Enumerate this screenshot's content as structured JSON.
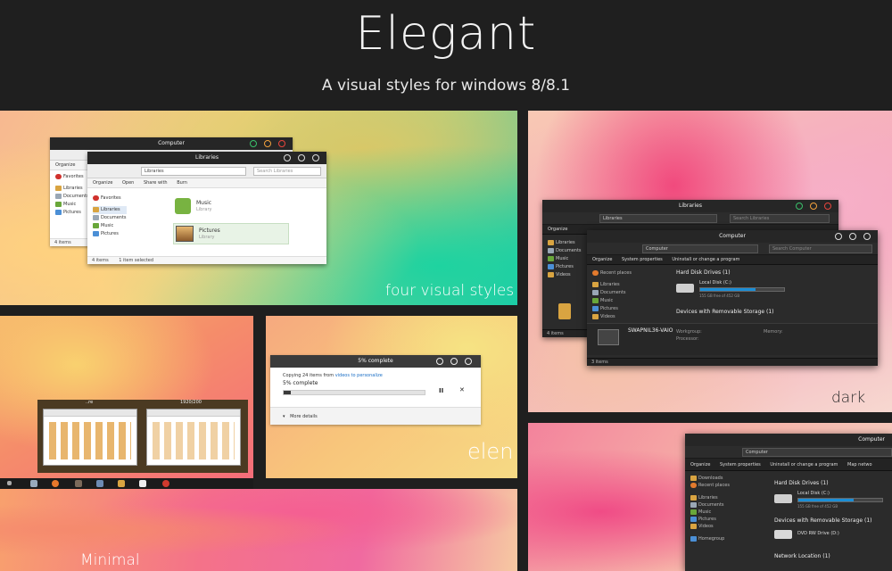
{
  "header": {
    "title": "Elegant",
    "subtitle": "A visual styles for windows 8/8.1"
  },
  "tiles": {
    "four": {
      "label": "four visual styles"
    },
    "dark": {
      "label": "dark"
    },
    "elem": {
      "label": "elen"
    },
    "minimal": {
      "label": "Minimal"
    }
  },
  "win_computer_light": {
    "title": "Computer",
    "organize": "Organize",
    "favorites": "Favorites",
    "libraries": "Libraries",
    "documents": "Documents",
    "music": "Music",
    "pictures": "Pictures",
    "items": "4 items"
  },
  "win_libraries_light": {
    "title": "Libraries",
    "address": "Libraries",
    "search_placeholder": "Search Libraries",
    "commands": [
      "Organize",
      "Open",
      "Share with",
      "Burn"
    ],
    "nav": [
      "Favorites",
      "Libraries",
      "Documents",
      "Music",
      "Pictures"
    ],
    "items": [
      {
        "name": "Music",
        "kind": "Library"
      },
      {
        "name": "Pictures",
        "kind": "Library"
      }
    ],
    "status_count": "4 items",
    "status_selected": "1 item selected"
  },
  "win_libraries_dark": {
    "title": "Libraries",
    "address": "Libraries",
    "search_placeholder": "Search Libraries",
    "organize": "Organize",
    "nav": [
      "Libraries",
      "Documents",
      "Music",
      "Pictures",
      "Videos"
    ],
    "status": "4 items"
  },
  "win_computer_dark": {
    "title": "Computer",
    "address": "Computer",
    "search_placeholder": "Search Computer",
    "commands": [
      "Organize",
      "System properties",
      "Uninstall or change a program"
    ],
    "nav": [
      "Recent places",
      "Libraries",
      "Documents",
      "Music",
      "Pictures",
      "Videos"
    ],
    "section_hdd": "Hard Disk Drives (1)",
    "disk_name": "Local Disk (C:)",
    "disk_free": "155 GB free of 452 GB",
    "disk_used_fraction": 0.66,
    "section_removable": "Devices with Removable Storage (1)",
    "computer_name": "SWAPNIL36-VAIO",
    "workgroup_label": "Workgroup:",
    "processor_label": "Processor:",
    "memory_label": "Memory:",
    "status": "3 items"
  },
  "win_computer_dark2": {
    "title": "Computer",
    "address": "Computer",
    "commands": [
      "Organize",
      "System properties",
      "Uninstall or change a program",
      "Map netwo"
    ],
    "nav": [
      "Downloads",
      "Recent places",
      "Libraries",
      "Documents",
      "Music",
      "Pictures",
      "Videos",
      "Homegroup"
    ],
    "section_hdd": "Hard Disk Drives (1)",
    "disk_name": "Local Disk (C:)",
    "disk_free": "155 GB free of 452 GB",
    "disk_used_fraction": 0.66,
    "section_removable": "Devices with Removable Storage (1)",
    "dvd": "DVD RW Drive (D:)",
    "section_network": "Network Location (1)"
  },
  "copy_dialog": {
    "title": "5% complete",
    "line1_prefix": "Copying 24 items from",
    "line1_link": "videos to personalize",
    "line2": "5% complete",
    "progress_fraction": 0.05,
    "pause": "II",
    "cancel": "✕",
    "more_details": "More details"
  },
  "thumbnails": {
    "left_label": "..re",
    "right_label": "1920/200"
  },
  "colors": {
    "background": "#1f1f1f",
    "title_text": "#f2f2f2",
    "accent_blue": "#1b8ed6"
  }
}
